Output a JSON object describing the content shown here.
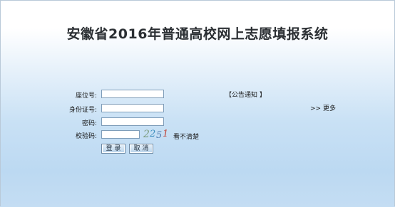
{
  "page": {
    "title": "安徽省2016年普通高校网上志愿填报系统"
  },
  "login": {
    "seat_label": "座位号:",
    "seat_value": "",
    "id_label": "身份证号:",
    "id_value": "",
    "password_label": "密码:",
    "password_value": "",
    "captcha_label": "校验码:",
    "captcha_value": "",
    "captcha_code": "2251",
    "refresh_label": "看不清楚",
    "login_button": "登 录",
    "cancel_button": "取 消"
  },
  "notice": {
    "open_bracket": "【",
    "title": "公告通知",
    "close_bracket": "】",
    "more_label": ">> 更多"
  }
}
